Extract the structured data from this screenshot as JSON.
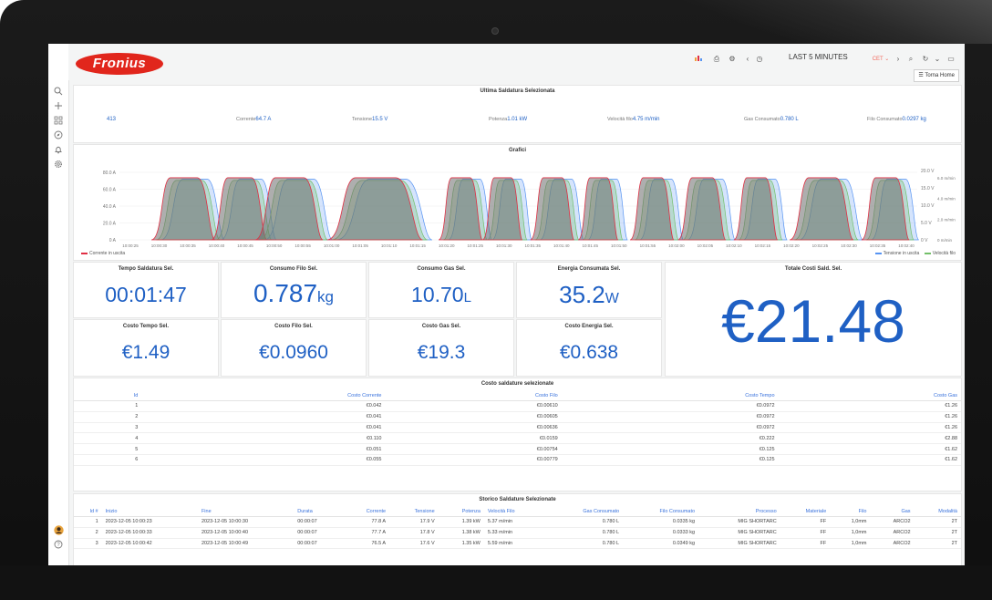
{
  "topbar": {
    "brand": "Fronius",
    "time_range": "LAST 5 MINUTES",
    "timezone": "CET",
    "home_button": "Torna Home",
    "icons": [
      "bar-chart-add-icon",
      "save-icon",
      "settings-icon",
      "chevron-left-icon",
      "clock-icon",
      "chevron-right-icon",
      "zoom-out-icon",
      "refresh-icon",
      "chevron-down-icon",
      "tv-icon"
    ]
  },
  "sidebar": {
    "icons": [
      "search-icon",
      "plus-icon",
      "dashboards-icon",
      "explore-icon",
      "bell-icon",
      "gear-icon",
      "avatar-icon",
      "help-icon"
    ]
  },
  "last_weld": {
    "title": "Ultima Saldatura Selezionata",
    "id_value": "413",
    "corrente_label": "Corrente",
    "corrente_value": "64.7 A",
    "tensione_label": "Tensione",
    "tensione_value": "15.5 V",
    "potenza_label": "Potenza",
    "potenza_value": "1.01 kW",
    "velocita_label": "Velocità filo",
    "velocita_value": "4.75 m/min",
    "gas_label": "Gas Consumato",
    "gas_value": "0.780 L",
    "filo_label": "Filo Consumato",
    "filo_value": "0.0297 kg"
  },
  "chart": {
    "title": "Grafici",
    "y_left_ticks": [
      "80.0 A",
      "60.0 A",
      "40.0 A",
      "20.0 A",
      "0 A"
    ],
    "y_right_v_ticks": [
      "20.0 V",
      "15.0 V",
      "10.0 V",
      "5.0 V",
      "0 V"
    ],
    "y_right_speed_ticks": [
      "6.0 m/min",
      "4.0 m/min",
      "2.0 m/min",
      "0 m/min"
    ],
    "x_ticks": [
      "10:00:25",
      "10:00:30",
      "10:00:35",
      "10:00:40",
      "10:00:45",
      "10:00:50",
      "10:00:55",
      "10:01:00",
      "10:01:05",
      "10:01:10",
      "10:01:15",
      "10:01:20",
      "10:01:25",
      "10:01:30",
      "10:01:35",
      "10:01:40",
      "10:01:45",
      "10:01:50",
      "10:01:55",
      "10:02:00",
      "10:02:05",
      "10:02:10",
      "10:02:15",
      "10:02:20",
      "10:02:25",
      "10:02:30",
      "10:02:35",
      "10:02:40"
    ],
    "legend_left": "Corrente in uscita",
    "legend_right_1": "Tensione in uscita",
    "legend_right_2": "Velocità filo",
    "colors": {
      "corrente": "#e02f44",
      "tensione": "#5794f2",
      "velocita": "#73bf69"
    }
  },
  "stats": {
    "tempo_title": "Tempo Saldatura Sel.",
    "tempo_value": "00:01:47",
    "filo_title": "Consumo Filo Sel.",
    "filo_value": "0.787",
    "filo_unit": "kg",
    "gas_title": "Consumo Gas Sel.",
    "gas_value": "10.70",
    "gas_unit": "L",
    "energia_title": "Energia Consumata Sel.",
    "energia_value": "35.2",
    "energia_unit": "W",
    "totale_title": "Totale Costi Sald. Sel.",
    "totale_value": "€21.48",
    "costo_tempo_title": "Costo Tempo Sel.",
    "costo_tempo_value": "€1.49",
    "costo_filo_title": "Costo Filo Sel.",
    "costo_filo_value": "€0.0960",
    "costo_gas_title": "Costo Gas Sel.",
    "costo_gas_value": "€19.3",
    "costo_energia_title": "Costo Energia Sel.",
    "costo_energia_value": "€0.638"
  },
  "cost_table": {
    "title": "Costo saldature selezionate",
    "headers": [
      "Id",
      "Costo Corrente",
      "Costo Filo",
      "Costo Tempo",
      "Costo Gas"
    ],
    "rows": [
      [
        "1",
        "€0.042",
        "€0.00610",
        "€0.0972",
        "€1.26"
      ],
      [
        "2",
        "€0.041",
        "€0.00605",
        "€0.0972",
        "€1.26"
      ],
      [
        "3",
        "€0.041",
        "€0.00636",
        "€0.0972",
        "€1.26"
      ],
      [
        "4",
        "€0.110",
        "€0.0159",
        "€0.222",
        "€2.88"
      ],
      [
        "5",
        "€0.051",
        "€0.00754",
        "€0.125",
        "€1.62"
      ],
      [
        "6",
        "€0.055",
        "€0.00779",
        "€0.125",
        "€1.62"
      ]
    ]
  },
  "history_table": {
    "title": "Storico Saldature Selezionate",
    "headers": [
      "Id #",
      "Inizio",
      "Fine",
      "Durata",
      "Corrente",
      "Tensione",
      "Potenza",
      "Velocità Filo",
      "Gas Consumato",
      "Filo Consumato",
      "Processo",
      "Materiale",
      "Filo",
      "Gas",
      "Modalità"
    ],
    "rows": [
      [
        "1",
        "2023-12-05 10:00:23",
        "2023-12-05 10:00:30",
        "00:00:07",
        "77.8 A",
        "17.9 V",
        "1.39 kW",
        "5.37 m/min",
        "0.780 L",
        "0.0335 kg",
        "MIG SHORTARC",
        "FF",
        "1,0mm",
        "ARCO2",
        "2T"
      ],
      [
        "2",
        "2023-12-05 10:00:33",
        "2023-12-05 10:00:40",
        "00:00:07",
        "77.7 A",
        "17.8 V",
        "1.38 kW",
        "5.33 m/min",
        "0.780 L",
        "0.0333 kg",
        "MIG SHORTARC",
        "FF",
        "1,0mm",
        "ARCO2",
        "2T"
      ],
      [
        "3",
        "2023-12-05 10:00:42",
        "2023-12-05 10:00:49",
        "00:00:07",
        "76.5 A",
        "17.6 V",
        "1.35 kW",
        "5.59 m/min",
        "0.780 L",
        "0.0349 kg",
        "MIG SHORTARC",
        "FF",
        "1,0mm",
        "ARCO2",
        "2T"
      ]
    ]
  }
}
